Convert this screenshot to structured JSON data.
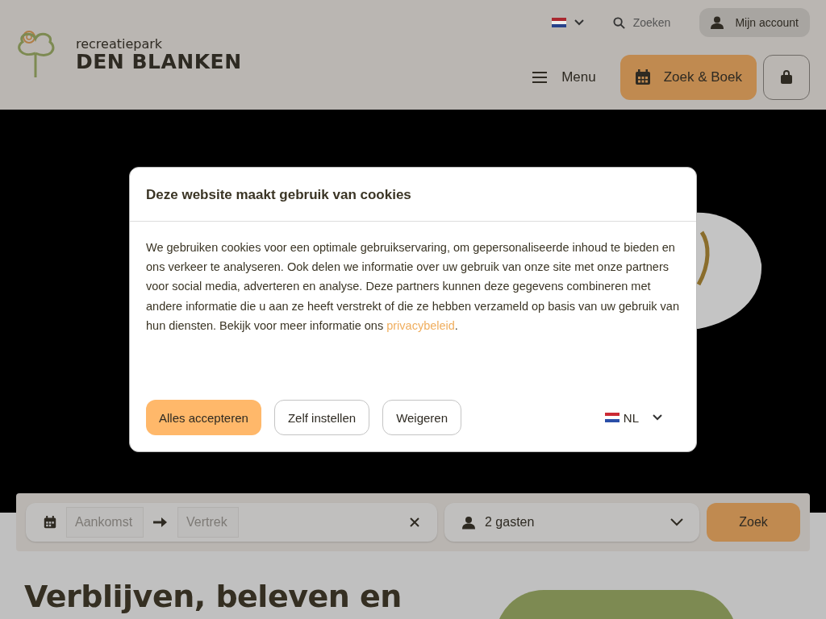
{
  "header": {
    "logo": {
      "tagline": "recreatiepark",
      "name": "DEN BLANKEN"
    },
    "search": {
      "label": "Zoeken"
    },
    "account_button": {
      "label": "Mijn account"
    },
    "menu_button": {
      "label": "Menu"
    },
    "book_button": {
      "label": "Zoek & Boek"
    }
  },
  "cookie_dialog": {
    "title": "Deze website maakt gebruik van cookies",
    "body": "We gebruiken cookies voor een optimale gebruikservaring, om gepersonaliseerde inhoud te bieden en ons verkeer te analyseren. Ook delen we informatie over uw gebruik van onze site met onze partners voor social media, adverteren en analyse. Deze partners kunnen deze gegevens combineren met andere informatie die u aan ze heeft verstrekt of die ze hebben verzameld op basis van uw gebruik van hun diensten. Bekijk voor meer informatie ons ",
    "link": "privacybeleid",
    "after_link": ".",
    "buttons": [
      {
        "label": "Alles accepteren",
        "kind": "primary"
      },
      {
        "label": "Zelf instellen",
        "kind": "outline"
      },
      {
        "label": "Weigeren",
        "kind": "outline"
      }
    ],
    "language": {
      "label": "NL"
    }
  },
  "booking_bar": {
    "arrival": {
      "placeholder": "Aankomst"
    },
    "departure": {
      "placeholder": "Vertrek"
    },
    "guests": {
      "value": "2 gasten"
    },
    "search_button": {
      "label": "Zoek"
    }
  },
  "intro": {
    "heading": "Verblijven, beleven en"
  }
}
